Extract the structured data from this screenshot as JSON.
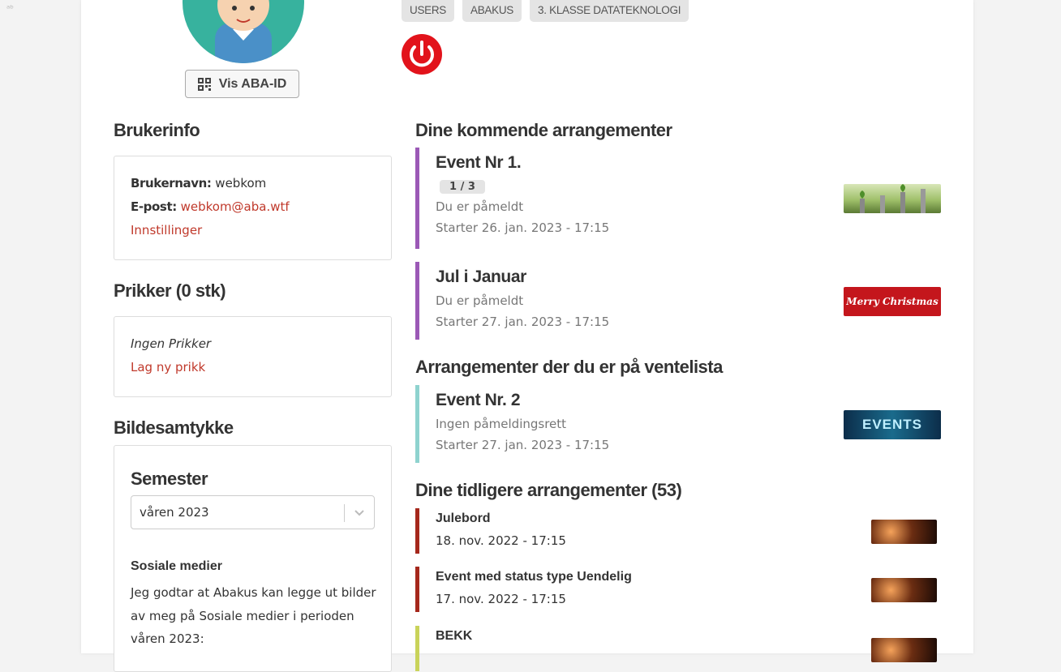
{
  "corner_glyph": "ᵃᵇ",
  "profile": {
    "aba_id_button": "Vis ABA-ID",
    "groups": [
      "USERS",
      "ABAKUS",
      "3. KLASSE DATATEKNOLOGI"
    ]
  },
  "userinfo": {
    "heading": "Brukerinfo",
    "username_label": "Brukernavn:",
    "username": "webkom",
    "email_label": "E-post:",
    "email": "webkom@aba.wtf",
    "settings_link": "Innstillinger"
  },
  "penalties": {
    "heading": "Prikker (0 stk)",
    "empty_text": "Ingen Prikker",
    "new_link": "Lag ny prikk"
  },
  "photo_consent": {
    "heading": "Bildesamtykke",
    "semester_heading": "Semester",
    "semester_value": "våren 2023",
    "social_heading": "Sosiale medier",
    "social_text": "Jeg godtar at Abakus kan legge ut bilder av meg på Sosiale medier i perioden våren 2023:"
  },
  "upcoming": {
    "heading": "Dine kommende arrangementer",
    "events": [
      {
        "title": "Event Nr 1.",
        "badge": "1 / 3",
        "status": "Du er påmeldt",
        "start": "Starter 26. jan. 2023 - 17:15",
        "color": "#9b59b6",
        "image": "plants"
      },
      {
        "title": "Jul i Januar",
        "status": "Du er påmeldt",
        "start": "Starter 27. jan. 2023 - 17:15",
        "color": "#9b59b6",
        "image": "christmas"
      }
    ]
  },
  "waitlist": {
    "heading": "Arrangementer der du er på ventelista",
    "events": [
      {
        "title": "Event Nr. 2",
        "status": "Ingen påmeldingsrett",
        "start": "Starter 27. jan. 2023 - 17:15",
        "color": "#8fd3cf",
        "image": "events-banner",
        "banner_text": "EVENTS"
      }
    ]
  },
  "past": {
    "heading": "Dine tidligere arrangementer (53)",
    "events": [
      {
        "title": "Julebord",
        "date": "18. nov. 2022 - 17:15",
        "color": "#a5281c"
      },
      {
        "title": "Event med status type Uendelig",
        "date": "17. nov. 2022 - 17:15",
        "color": "#a5281c"
      },
      {
        "title": "BEKK",
        "date": "",
        "color": "#c9d35a"
      }
    ]
  },
  "images": {
    "christmas_text": "Merry Christmas"
  }
}
